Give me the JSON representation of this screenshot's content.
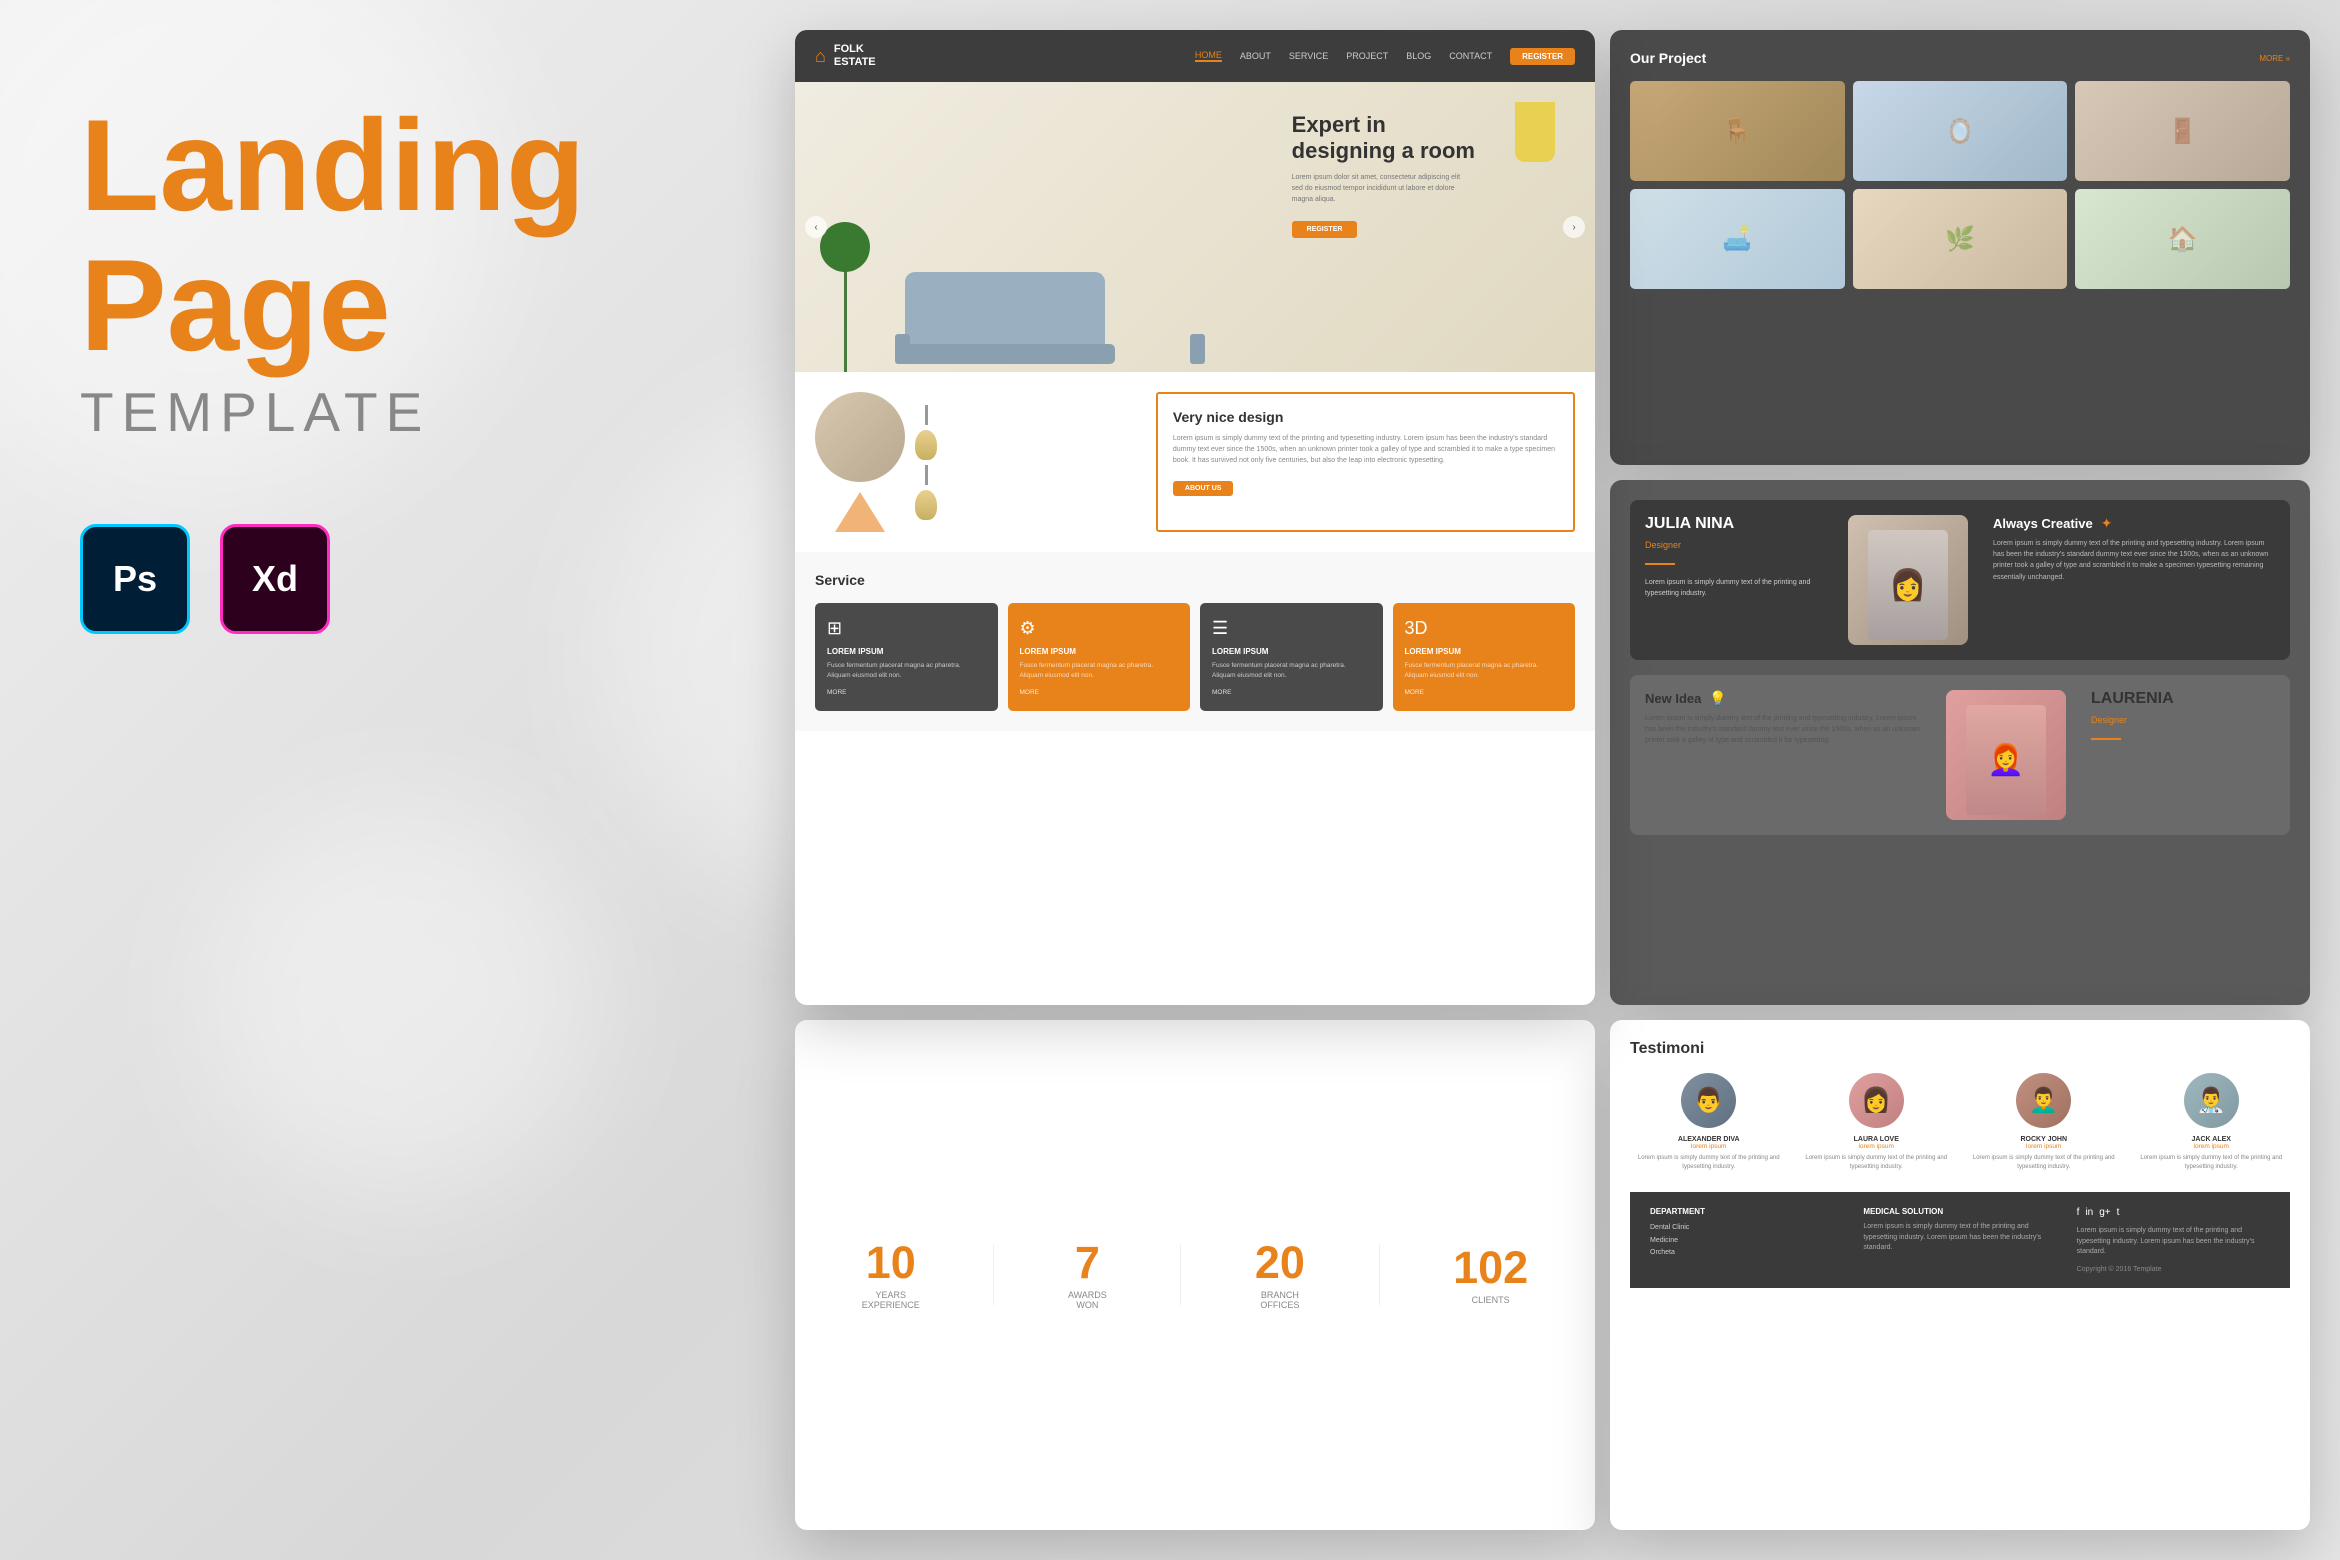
{
  "page": {
    "title": "Landing Page Template",
    "bg_color": "#e8e8e8"
  },
  "left_panel": {
    "heading_line1": "Landing",
    "heading_line2": "Page",
    "subheading": "TEMPLATE",
    "ps_label": "Ps",
    "xd_label": "Xd"
  },
  "nav": {
    "logo_name": "FOLK",
    "logo_sub": "ESTATE",
    "links": [
      "HOME",
      "ABOUT",
      "SERVICE",
      "PROJECT",
      "BLOG",
      "CONTACT"
    ],
    "active_link": "HOME",
    "register_btn": "REGISTER"
  },
  "hero": {
    "title": "Expert in\ndesigning a room",
    "description": "Lorem ipsum dolor sit amet, consectetur adipiscing elit sed do eiusmod tempor incididunt ut labore et dolore magna aliqua.",
    "cta_btn": "REGISTER",
    "prev_btn": "‹",
    "next_btn": "›"
  },
  "design_section": {
    "title": "Very nice design",
    "description": "Lorem ipsum is simply dummy text of the printing and typesetting industry. Lorem ipsum has been the industry's standard dummy text ever since the 1500s, when an unknown printer took a galley of type and scrambled it to make a type specimen book. It has survived not only five centuries, but also the leap into electronic typesetting.",
    "about_btn": "ABOUT US"
  },
  "service": {
    "title": "Service",
    "cards": [
      {
        "icon": "⊞",
        "title": "LOREM IPSUM",
        "desc": "Fusce fermentum placerat magna ac pharetra. Aliquam eiusmod elit non magna consectetur.",
        "more": "MORE"
      },
      {
        "icon": "⚙",
        "title": "LOREM IPSUM",
        "desc": "Fusce fermentum placerat magna ac pharetra. Aliquam eiusmod elit non magna consectetur.",
        "more": "MORE"
      },
      {
        "icon": "☰",
        "title": "LOREM IPSUM",
        "desc": "Fusce fermentum placerat magna ac pharetra. Aliquam eiusmod elit non magna consectetur.",
        "more": "MORE"
      },
      {
        "icon": "3D",
        "title": "LOREM IPSUM",
        "desc": "Fusce fermentum placerat magna ac pharetra. Aliquam eiusmod elit non magna consectetur.",
        "more": "MORE"
      }
    ]
  },
  "projects": {
    "title": "Our Project",
    "more_label": "MORE »"
  },
  "team": {
    "members": [
      {
        "name": "JULIA NINA",
        "role": "Designer",
        "about_title": "Always Creative",
        "about_desc": "Lorem ipsum is simply dummy text of the printing and typesetting industry. Lorem ipsum has been the industry's standard dummy text ever since the 1500s, when as an unknown printer took a galley of type and scrambled it to make a specimen typesetting.",
        "icon": "✦"
      },
      {
        "name": "LAURENIA",
        "role": "Designer",
        "about_title": "New Idea",
        "about_desc": "Lorem ipsum is simply dummy text of the printing and typesetting industry. Lorem ipsum has been the industry's standard dummy text ever since the 1500s, when as an unknown printer took a galley of type and scrambled it for typesetting.",
        "icon": "💡"
      }
    ]
  },
  "stats": [
    {
      "number": "10",
      "label": "Years\nExperience"
    },
    {
      "number": "7",
      "label": "Awards\nWon"
    },
    {
      "number": "20",
      "label": "Branch\nOffices"
    },
    {
      "number": "102",
      "label": "Clients"
    }
  ],
  "testimonials": {
    "title": "Testimoni",
    "items": [
      {
        "name": "ALEXANDER DIVA",
        "role": "lorem ipsum",
        "desc": "Lorem ipsum is simply dummy text of the printing and typesetting industry."
      },
      {
        "name": "LAURA LOVE",
        "role": "lorem ipsum",
        "desc": "Lorem ipsum is simply dummy text of the printing and typesetting industry."
      },
      {
        "name": "ROCKY JOHN",
        "role": "lorem ipsum",
        "desc": "Lorem ipsum is simply dummy text of the printing and typesetting industry."
      },
      {
        "name": "JACK ALEX",
        "role": "lorem ipsum",
        "desc": "Lorem ipsum is simply dummy text of the printing and typesetting industry."
      }
    ]
  },
  "footer": {
    "department": {
      "title": "DEPARTMENT",
      "links": [
        "Dental Clinic",
        "Medicine",
        "Orcheta"
      ]
    },
    "medical": {
      "title": "MEDICAL SOLUTION",
      "desc": "Lorem ipsum is simply dummy text of the printing and typesetting industry. Lorem ipsum has been the industry's standard."
    },
    "social_icons": [
      "f",
      "in",
      "g+",
      "t"
    ],
    "about_desc": "Lorem ipsum is simply dummy text of the printing and typesetting industry. Lorem ipsum has been the industry's standard.",
    "copyright": "Copyright © 2016 Template"
  }
}
